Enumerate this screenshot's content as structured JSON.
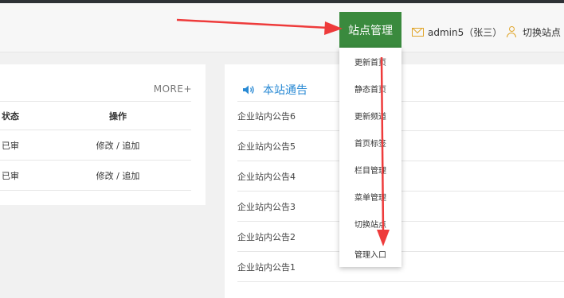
{
  "header": {
    "site_management": "站点管理",
    "admin_text": "admin5（张三）",
    "switch_site": "切换站点"
  },
  "dropdown": {
    "items": [
      "更新首页",
      "静态首页",
      "更新频道",
      "首页标签",
      "栏目管理",
      "菜单管理",
      "切换站点",
      "管理入口"
    ]
  },
  "left_panel": {
    "more": "MORE+",
    "columns": {
      "status": "状态",
      "operation": "操作"
    },
    "rows": [
      {
        "status": "已审",
        "edit": "修改",
        "sep": " / ",
        "append": "追加"
      },
      {
        "status": "已审",
        "edit": "修改",
        "sep": " / ",
        "append": "追加"
      }
    ]
  },
  "notice": {
    "title": "本站通告",
    "items": [
      "企业站内公告6",
      "企业站内公告5",
      "企业站内公告4",
      "企业站内公告3",
      "企业站内公告2",
      "企业站内公告1"
    ]
  },
  "colors": {
    "accent_green": "#3a8a3e",
    "notice_blue": "#2a8ad4",
    "icon_orange": "#e0a52a",
    "arrow_red": "#ee3b3b"
  },
  "icons": [
    "mail-icon",
    "user-switch-icon",
    "speaker-icon"
  ]
}
